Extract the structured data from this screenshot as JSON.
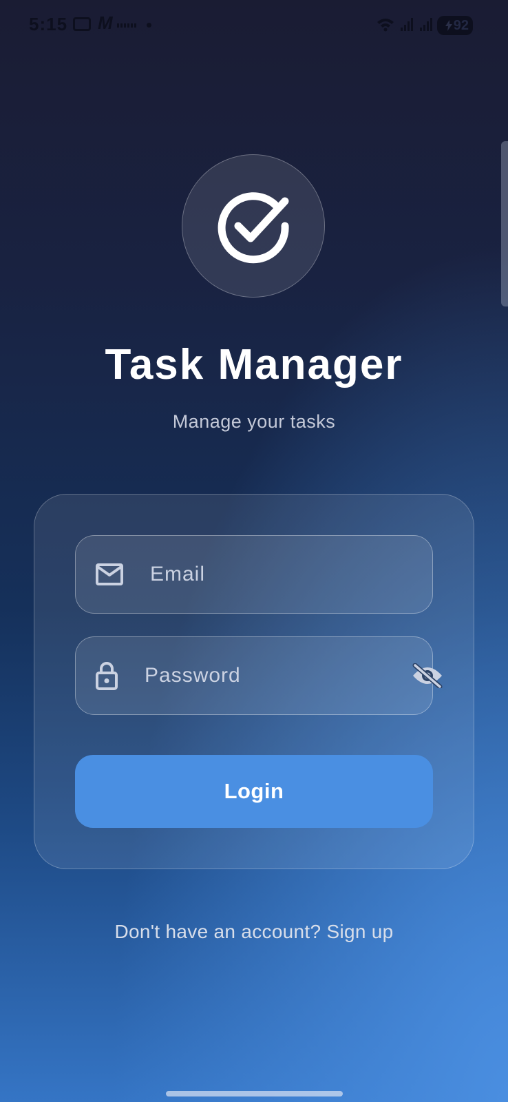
{
  "status_bar": {
    "time": "5:15",
    "battery": "92",
    "icons": [
      "screenshot-icon",
      "m-icon",
      "notification-icon",
      "dot-icon",
      "wifi-icon",
      "signal-icon",
      "signal-icon",
      "battery-charging-icon"
    ]
  },
  "app": {
    "logo_icon": "check-circle-icon",
    "title": "Task Manager",
    "subtitle": "Manage your tasks"
  },
  "form": {
    "email": {
      "icon": "mail-icon",
      "placeholder": "Email",
      "value": ""
    },
    "password": {
      "icon": "lock-icon",
      "placeholder": "Password",
      "value": "",
      "toggle_icon": "eye-off-icon"
    },
    "login_label": "Login"
  },
  "signup_prompt": "Don't have an account? Sign up",
  "colors": {
    "accent": "#4a8fe2",
    "bg_top": "#1a1c33",
    "bg_bottom": "#3575c5"
  }
}
